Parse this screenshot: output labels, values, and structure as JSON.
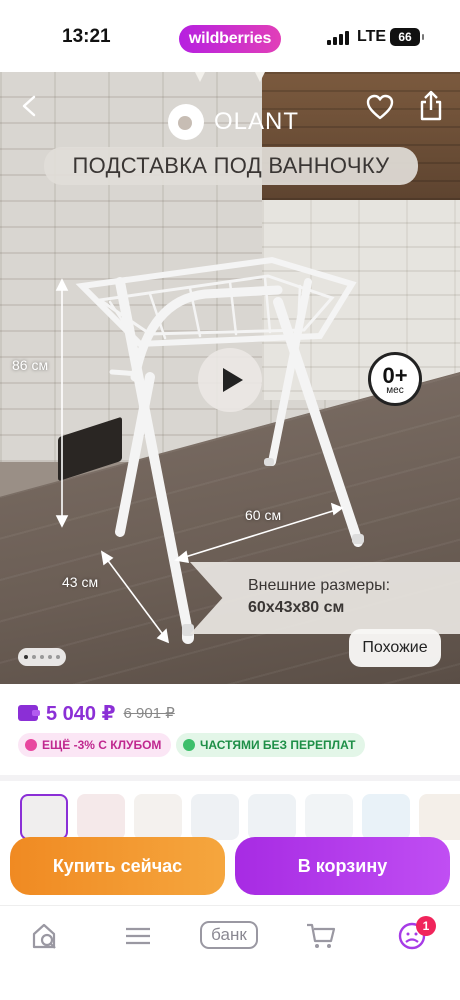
{
  "status_bar": {
    "time": "13:21",
    "app_pill": "wildberries",
    "network": "LTE",
    "battery": "66"
  },
  "hero": {
    "brand": "OLANT",
    "title": "ПОДСТАВКА ПОД ВАННОЧКУ",
    "dim_height": "86 см",
    "dim_width": "60 см",
    "dim_depth": "43 см",
    "age_main": "0+",
    "age_sub": "мес",
    "size_label": "Внешние размеры:",
    "size_value": "60х43х80 см",
    "similar_button": "Похожие"
  },
  "price": {
    "current": "5 040 ₽",
    "old": "6 901 ₽"
  },
  "chips": {
    "club": "ЕЩЁ -3% С КЛУБОМ",
    "parts": "ЧАСТЯМИ БЕЗ ПЕРЕПЛАТ"
  },
  "actions": {
    "buy_now": "Купить сейчас",
    "to_cart": "В корзину"
  },
  "bottom_nav": {
    "bank": "банк",
    "profile_badge": "1"
  },
  "colors": {
    "accent": "#8b2fd6",
    "buy": "#f08a22",
    "cart": "#b63ded",
    "club": "#c0288f",
    "parts": "#1e8f47"
  }
}
